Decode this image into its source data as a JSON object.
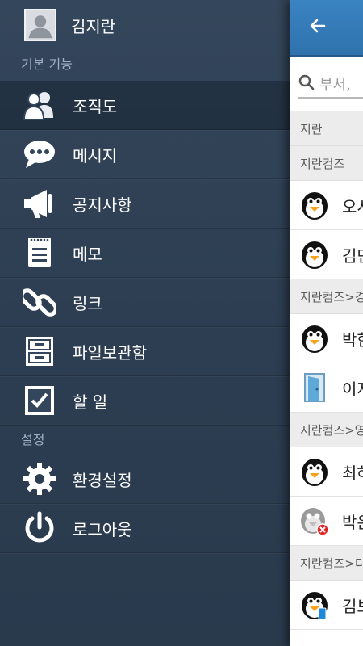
{
  "drawer": {
    "profile_name": "김지란",
    "section_basic": "기본 기능",
    "section_settings": "설정",
    "items": [
      {
        "label": "조직도"
      },
      {
        "label": "메시지"
      },
      {
        "label": "공지사항"
      },
      {
        "label": "메모"
      },
      {
        "label": "링크"
      },
      {
        "label": "파일보관함"
      },
      {
        "label": "할 일"
      }
    ],
    "settings_items": [
      {
        "label": "환경설정"
      },
      {
        "label": "로그아웃"
      }
    ]
  },
  "main": {
    "search_placeholder": "부서,",
    "groups": [
      {
        "header": "지란"
      },
      {
        "header": "지란컴즈"
      },
      {
        "header": "지란컴즈>경"
      },
      {
        "header": "지란컴즈>영"
      },
      {
        "header": "지란컴즈>디"
      }
    ],
    "contacts": [
      {
        "name": "오시"
      },
      {
        "name": "김민"
      },
      {
        "name": "박한"
      },
      {
        "name": "이지"
      },
      {
        "name": "최하"
      },
      {
        "name": "박은"
      },
      {
        "name": "김보"
      }
    ]
  }
}
